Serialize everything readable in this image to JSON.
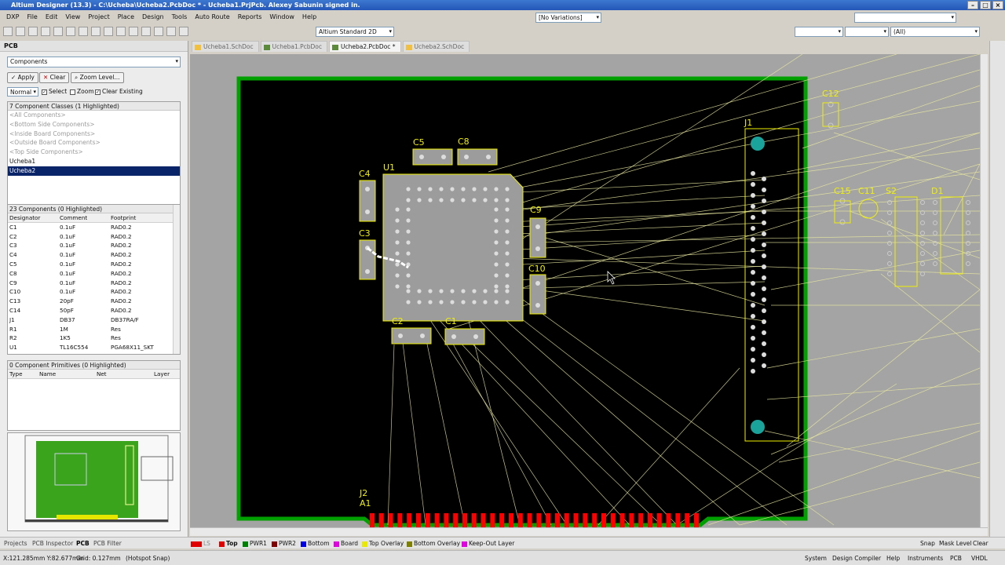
{
  "window": {
    "title": "Altium Designer (13.3) - C:\\Ucheba\\Ucheba2.PcbDoc * - Ucheba1.PrjPcb. Alexey Sabunin signed in."
  },
  "menu": {
    "dxp": "DXP",
    "items": [
      "File",
      "Edit",
      "View",
      "Project",
      "Place",
      "Design",
      "Tools",
      "Auto Route",
      "Reports",
      "Window",
      "Help"
    ]
  },
  "toolbar": {
    "variations": "[No Variations]",
    "view_mode": "Altium Standard 2D",
    "filter_all": "(All)"
  },
  "panel": {
    "title": "PCB",
    "mode_select": "Components",
    "apply": "Apply",
    "clear": "Clear",
    "zoom_level": "Zoom Level...",
    "normal": "Normal",
    "select": "Select",
    "zoom": "Zoom",
    "clear_existing": "Clear Existing",
    "classes_header": "7 Component Classes (1 Highlighted)",
    "classes": [
      "<All Components>",
      "<Bottom Side Components>",
      "<Inside Board Components>",
      "<Outside Board Components>",
      "<Top Side Components>",
      "Ucheba1",
      "Ucheba2"
    ],
    "components_header": "23 Components (0 Highlighted)",
    "columns": [
      "Designator",
      "Comment",
      "Footprint"
    ],
    "rows": [
      [
        "C1",
        "0.1uF",
        "RAD0.2"
      ],
      [
        "C2",
        "0.1uF",
        "RAD0.2"
      ],
      [
        "C3",
        "0.1uF",
        "RAD0.2"
      ],
      [
        "C4",
        "0.1uF",
        "RAD0.2"
      ],
      [
        "C5",
        "0.1uF",
        "RAD0.2"
      ],
      [
        "C8",
        "0.1uF",
        "RAD0.2"
      ],
      [
        "C9",
        "0.1uF",
        "RAD0.2"
      ],
      [
        "C10",
        "0.1uF",
        "RAD0.2"
      ],
      [
        "C13",
        "20pF",
        "RAD0.2"
      ],
      [
        "C14",
        "50pF",
        "RAD0.2"
      ],
      [
        "J1",
        "DB37",
        "DB37RA/F"
      ],
      [
        "R1",
        "1M",
        "Res"
      ],
      [
        "R2",
        "1K5",
        "Res"
      ],
      [
        "U1",
        "TL16C554",
        "PGA68X11_SKT"
      ]
    ],
    "primitives_header": "0 Component Primitives (0 Highlighted)",
    "prim_columns": [
      "Type",
      "Name",
      "Net",
      "Layer"
    ]
  },
  "tabs": [
    "Ucheba1.SchDoc",
    "Ucheba1.PcbDoc",
    "Ucheba2.PcbDoc *",
    "Ucheba2.SchDoc"
  ],
  "designators": {
    "u1": "U1",
    "c4": "C4",
    "c3": "C3",
    "c5": "C5",
    "c8": "C8",
    "c9": "C9",
    "c10": "C10",
    "c2": "C2",
    "c1": "C1",
    "j1": "J1",
    "j2": "J2",
    "a1": "A1",
    "c12": "C12",
    "c15": "C15",
    "c11": "C11",
    "s2": "S2",
    "d1": "D1"
  },
  "bottom_tabs": [
    "Projects",
    "PCB Inspector",
    "PCB",
    "PCB Filter"
  ],
  "layers": [
    {
      "name": "LS",
      "color": "#e00000"
    },
    {
      "name": "Top",
      "color": "#e00000"
    },
    {
      "name": "PWR1",
      "color": "#008000"
    },
    {
      "name": "PWR2",
      "color": "#800000"
    },
    {
      "name": "Bottom",
      "color": "#0000e0"
    },
    {
      "name": "Board",
      "color": "#e000e0"
    },
    {
      "name": "Top Overlay",
      "color": "#e8e800"
    },
    {
      "name": "Bottom Overlay",
      "color": "#808000"
    },
    {
      "name": "Keep-Out Layer",
      "color": "#e000e0"
    }
  ],
  "layer_right": [
    "Snap",
    "Mask Level",
    "Clear"
  ],
  "status": {
    "coords": "X:121.285mm Y:82.677mm",
    "grid": "Grid: 0.127mm",
    "snap": "(Hotspot Snap)"
  },
  "status_right": [
    "System",
    "Design Compiler",
    "Help",
    "Instruments",
    "PCB",
    "VHDL"
  ],
  "colors": {
    "board": "#000000",
    "outline": "#00a000",
    "overlay": "#f0f000",
    "pad": "#c8c8c8",
    "via": "#1aa39a",
    "track": "#ff0000",
    "ratsnest": "#e8e8a0"
  }
}
